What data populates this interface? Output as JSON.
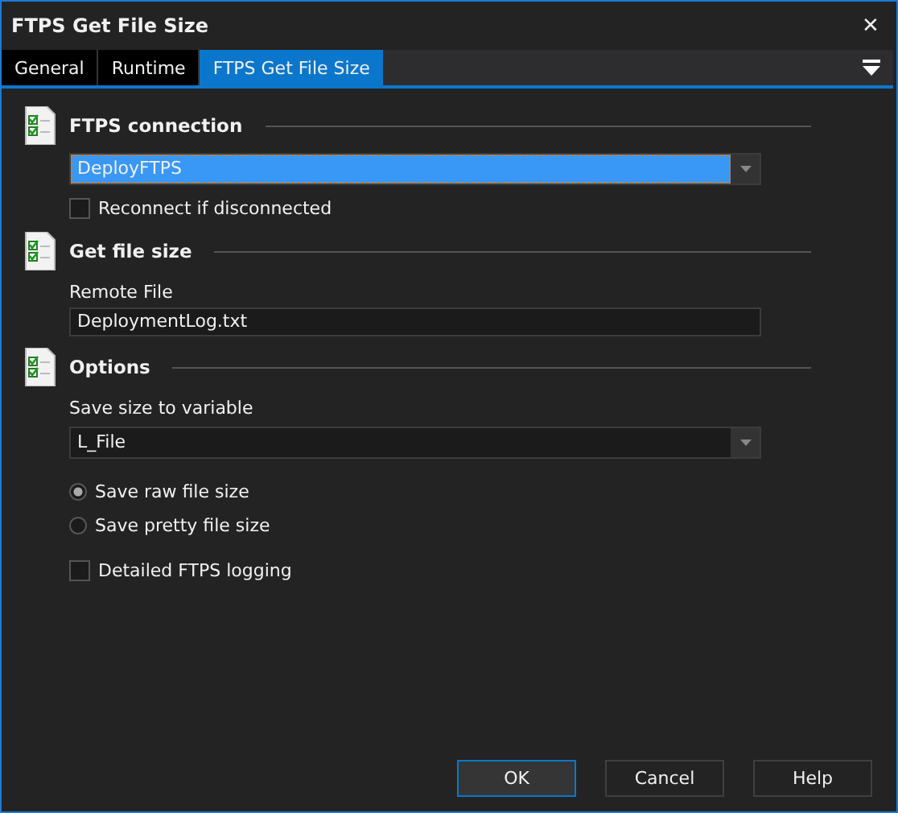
{
  "window": {
    "title": "FTPS Get File Size",
    "close": "✕"
  },
  "tabs": [
    {
      "label": "General",
      "selected": false
    },
    {
      "label": "Runtime",
      "selected": false
    },
    {
      "label": "FTPS Get File Size",
      "selected": true
    }
  ],
  "sections": [
    {
      "title": "FTPS connection",
      "items": [
        {
          "kind": "dropdown",
          "value": "DeployFTPS",
          "focused": true
        },
        {
          "kind": "checkbox",
          "label": "Reconnect if disconnected",
          "checked": false
        }
      ]
    },
    {
      "title": "Get file size",
      "items": [
        {
          "kind": "label",
          "label": "Remote File"
        },
        {
          "kind": "text",
          "value": "DeploymentLog.txt"
        }
      ]
    },
    {
      "title": "Options",
      "items": [
        {
          "kind": "label",
          "label": "Save size to variable"
        },
        {
          "kind": "dropdown",
          "value": "L_File",
          "focused": false
        },
        {
          "kind": "radio",
          "label": "Save raw file size",
          "selected": true
        },
        {
          "kind": "radio",
          "label": "Save pretty file size",
          "selected": false
        },
        {
          "kind": "checkbox",
          "label": "Detailed FTPS logging",
          "checked": false
        }
      ]
    }
  ],
  "buttons": [
    {
      "label": "OK",
      "default": true
    },
    {
      "label": "Cancel",
      "default": false
    },
    {
      "label": "Help",
      "default": false
    }
  ]
}
